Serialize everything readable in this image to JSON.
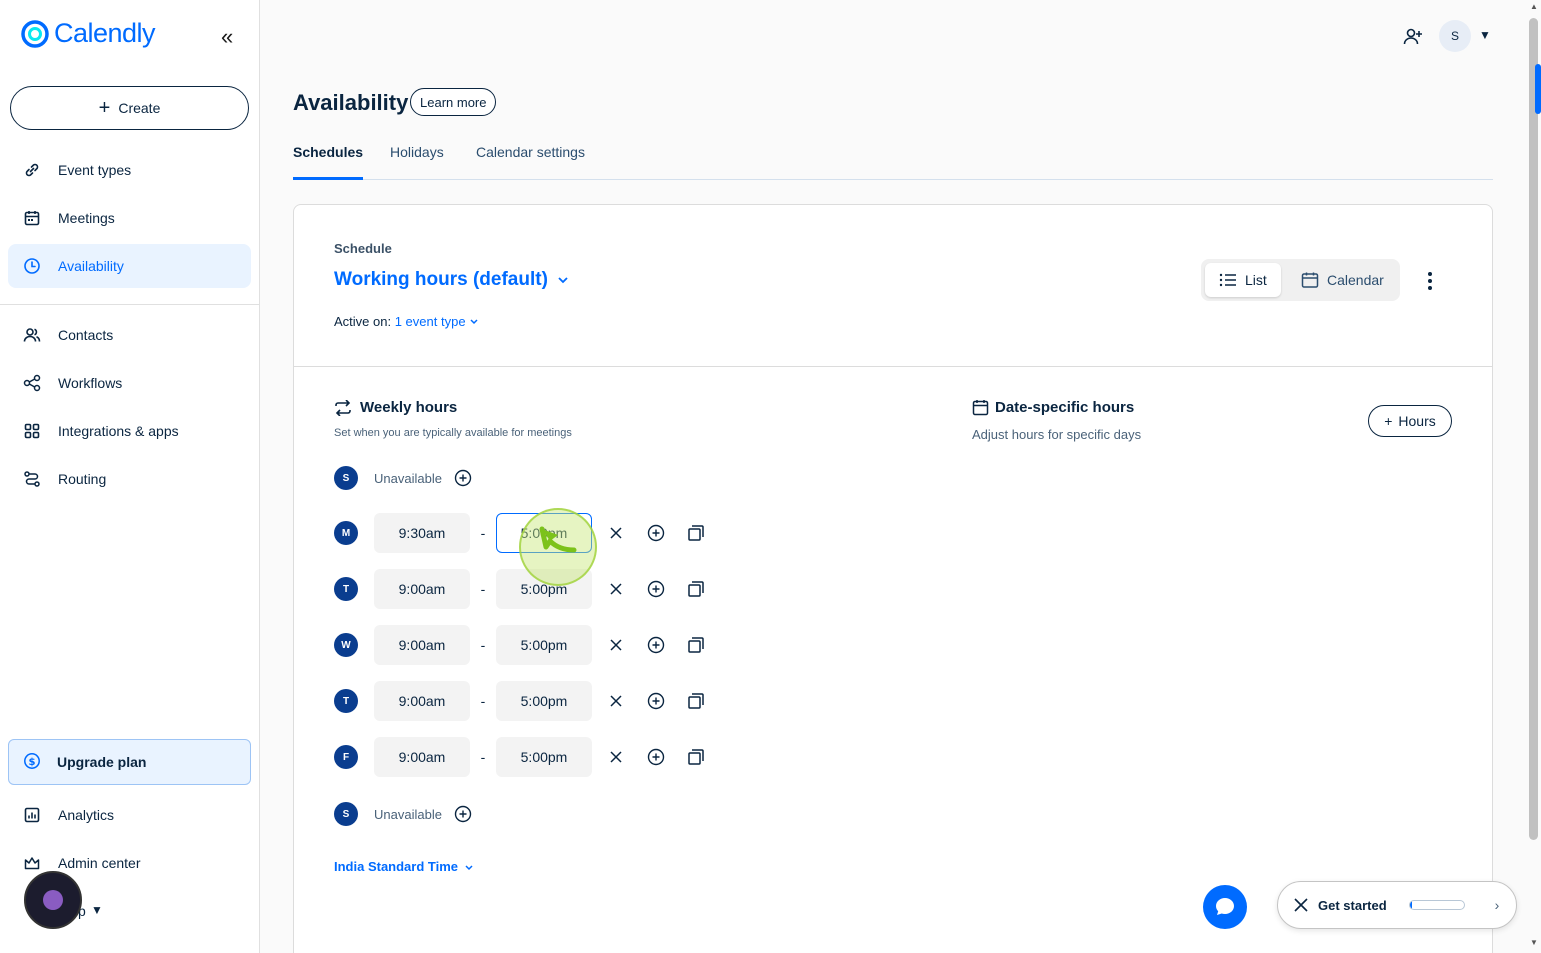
{
  "brand": {
    "name": "Calendly",
    "color": "#006bff"
  },
  "sidebar": {
    "collapse_icon": "double-chevron-left-icon",
    "create_label": "Create",
    "items": [
      {
        "label": "Event types",
        "icon": "link-icon"
      },
      {
        "label": "Meetings",
        "icon": "calendar-icon"
      },
      {
        "label": "Availability",
        "icon": "clock-icon",
        "active": true
      },
      {
        "label": "Contacts",
        "icon": "contacts-icon"
      },
      {
        "label": "Workflows",
        "icon": "workflow-icon"
      },
      {
        "label": "Integrations & apps",
        "icon": "apps-grid-icon"
      },
      {
        "label": "Routing",
        "icon": "routing-icon"
      }
    ],
    "upgrade_label": "Upgrade plan",
    "bottom_items": [
      {
        "label": "Analytics",
        "icon": "analytics-icon"
      },
      {
        "label": "Admin center",
        "icon": "crown-icon"
      }
    ],
    "help_label": "p"
  },
  "topbar": {
    "avatar_initial": "S"
  },
  "page": {
    "title": "Availability",
    "learn_more": "Learn more",
    "tabs": [
      {
        "label": "Schedules",
        "active": true
      },
      {
        "label": "Holidays"
      },
      {
        "label": "Calendar settings"
      }
    ]
  },
  "schedule": {
    "label": "Schedule",
    "name": "Working hours (default)",
    "active_on_label": "Active on:",
    "active_on_value": "1 event type",
    "view_list": "List",
    "view_calendar": "Calendar"
  },
  "weekly": {
    "title": "Weekly hours",
    "subtitle": "Set when you are typically available for meetings",
    "days": [
      {
        "letter": "S",
        "unavailable": "Unavailable"
      },
      {
        "letter": "M",
        "start": "9:30am",
        "end": "5:00pm",
        "focused": true
      },
      {
        "letter": "T",
        "start": "9:00am",
        "end": "5:00pm"
      },
      {
        "letter": "W",
        "start": "9:00am",
        "end": "5:00pm"
      },
      {
        "letter": "T",
        "start": "9:00am",
        "end": "5:00pm"
      },
      {
        "letter": "F",
        "start": "9:00am",
        "end": "5:00pm"
      },
      {
        "letter": "S",
        "unavailable": "Unavailable"
      }
    ],
    "separator": "-",
    "timezone": "India Standard Time"
  },
  "date_specific": {
    "title": "Date-specific hours",
    "subtitle": "Adjust hours for specific days",
    "add_label": "Hours"
  },
  "get_started": {
    "label": "Get started",
    "progress": 0.05
  }
}
